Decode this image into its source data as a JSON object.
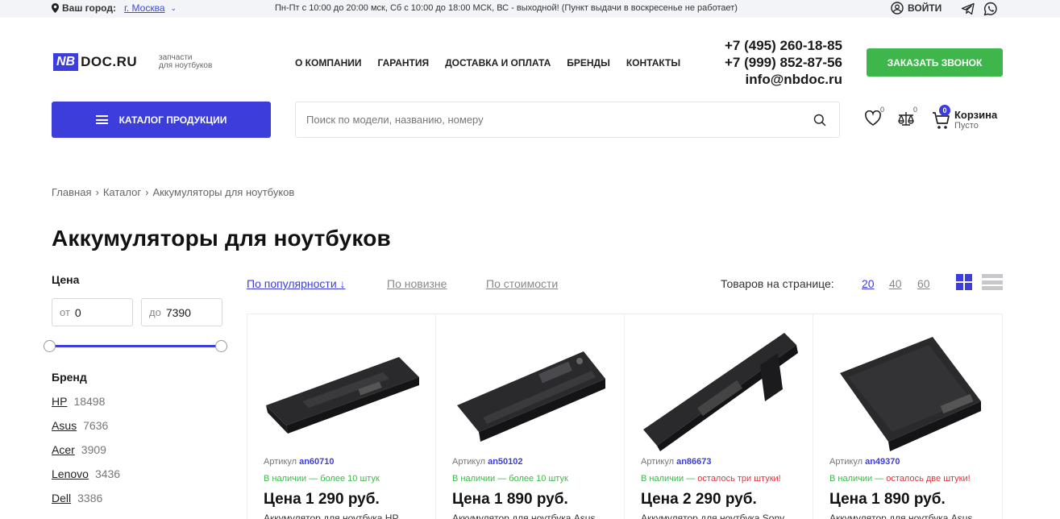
{
  "topbar": {
    "city_label": "Ваш город:",
    "city_value": "г. Москва",
    "hours": "Пн-Пт с 10:00 до 20:00 мск, Сб с 10:00 до 18:00 МСК, ВС - выходной! (Пункт выдачи в воскресенье не работает)",
    "login": "ВОЙТИ"
  },
  "header": {
    "logo_nb": "NB",
    "logo_doc": "DOC.RU",
    "tagline_1": "запчасти",
    "tagline_2": "для ноутбуков",
    "nav": [
      "О КОМПАНИИ",
      "ГАРАНТИЯ",
      "ДОСТАВКА И ОПЛАТА",
      "БРЕНДЫ",
      "КОНТАКТЫ"
    ],
    "phone_1": "+7 (495) 260-18-85",
    "phone_2": "+7 (999) 852-87-56",
    "email": "info@nbdoc.ru",
    "callback": "ЗАКАЗАТЬ ЗВОНОК"
  },
  "toolbar": {
    "catalog": "КАТАЛОГ ПРОДУКЦИИ",
    "search_placeholder": "Поиск по модели, названию, номеру",
    "favorites_count": "0",
    "compare_count": "0",
    "cart_count": "0",
    "cart_title": "Корзина",
    "cart_status": "Пусто"
  },
  "breadcrumb": [
    "Главная",
    "Каталог",
    "Аккумуляторы для ноутбуков"
  ],
  "page_title": "Аккумуляторы для ноутбуков",
  "filters": {
    "price_heading": "Цена",
    "price_from_label": "от",
    "price_from": "0",
    "price_to_label": "до",
    "price_to": "7390",
    "brand_heading": "Бренд",
    "brands": [
      {
        "name": "HP",
        "count": "18498"
      },
      {
        "name": "Asus",
        "count": "7636"
      },
      {
        "name": "Acer",
        "count": "3909"
      },
      {
        "name": "Lenovo",
        "count": "3436"
      },
      {
        "name": "Dell",
        "count": "3386"
      }
    ]
  },
  "sorting": {
    "popular": "По популярности ↓",
    "newest": "По новизне",
    "price": "По стоимости",
    "per_page_label": "Товаров на странице:",
    "per_page": [
      "20",
      "40",
      "60"
    ]
  },
  "products": [
    {
      "sku_label": "Артикул",
      "sku": "an60710",
      "stock": "В наличии — более 10 штук",
      "stock_warn": "",
      "price": "Цена 1 290 руб.",
      "name": "Аккумулятор для ноутбука HP"
    },
    {
      "sku_label": "Артикул",
      "sku": "an50102",
      "stock": "В наличии — более 10 штук",
      "stock_warn": "",
      "price": "Цена 1 890 руб.",
      "name": "Аккумулятор для ноутбука Asus"
    },
    {
      "sku_label": "Артикул",
      "sku": "an86673",
      "stock": "В наличии — ",
      "stock_warn": "осталось три штуки!",
      "price": "Цена 2 290 руб.",
      "name": "Аккумулятор для ноутбука Sony"
    },
    {
      "sku_label": "Артикул",
      "sku": "an49370",
      "stock": "В наличии — ",
      "stock_warn": "осталось две штуки!",
      "price": "Цена 1 890 руб.",
      "name": "Аккумулятор для ноутбука Asus"
    }
  ]
}
